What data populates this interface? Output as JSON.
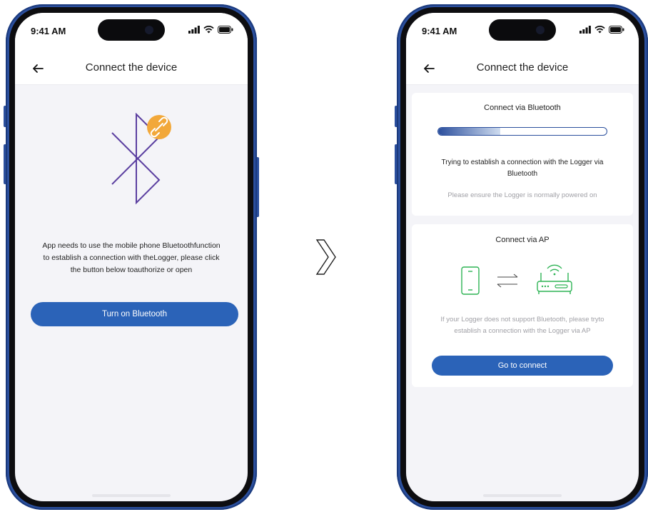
{
  "status": {
    "time": "9:41 AM"
  },
  "left_phone": {
    "nav_title": "Connect the device",
    "description_lines": [
      "App needs to use the mobile phone Bluetoothfunction",
      "to establish a connection with theLogger, please click",
      "the button below toauthorize or open"
    ],
    "button_label": "Turn on Bluetooth"
  },
  "right_phone": {
    "nav_title": "Connect the device",
    "bluetooth_card": {
      "title": "Connect via Bluetooth",
      "progress_fraction": 0.37,
      "message_lines": [
        "Trying to establish a connection with the Logger via",
        "Bluetooth"
      ],
      "note": "Please ensure the Logger is normally powered on"
    },
    "ap_card": {
      "title": "Connect via AP",
      "message_lines": [
        "If your Logger does not support Bluetooth, please tryto",
        "establish a connection with the Logger via AP"
      ],
      "button_label": "Go to connect"
    }
  },
  "colors": {
    "accent": "#2b63b8",
    "frame": "#2b4f9d",
    "bluetooth_purple": "#5b3fa0",
    "badge_orange": "#f2a83a",
    "ap_green": "#2db354"
  },
  "icons": {
    "back": "arrow-left-icon",
    "signal": "cellular-signal-icon",
    "wifi": "wifi-icon",
    "battery": "battery-icon",
    "bluetooth": "bluetooth-icon",
    "link_badge": "link-icon",
    "phone": "mobile-phone-icon",
    "transfer": "two-way-arrows-icon",
    "router": "router-icon",
    "next": "chevron-right-icon"
  }
}
